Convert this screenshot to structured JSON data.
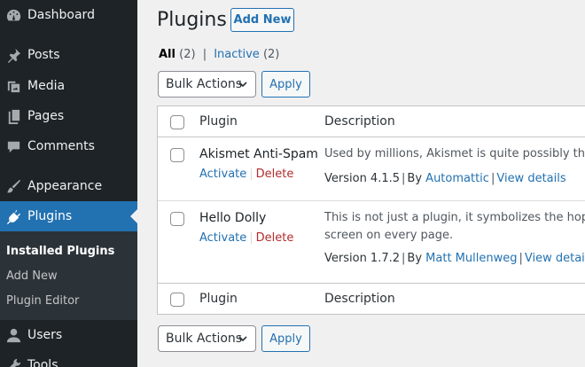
{
  "sidebar": {
    "items": [
      {
        "label": "Dashboard",
        "icon": "dashboard-icon"
      },
      {
        "label": "Posts",
        "icon": "pin-icon"
      },
      {
        "label": "Media",
        "icon": "media-icon"
      },
      {
        "label": "Pages",
        "icon": "pages-icon"
      },
      {
        "label": "Comments",
        "icon": "comment-icon"
      },
      {
        "label": "Appearance",
        "icon": "brush-icon"
      },
      {
        "label": "Plugins",
        "icon": "plug-icon",
        "active": true
      },
      {
        "label": "Users",
        "icon": "user-icon"
      },
      {
        "label": "Tools",
        "icon": "wrench-icon"
      }
    ],
    "submenu": [
      "Installed Plugins",
      "Add New",
      "Plugin Editor"
    ]
  },
  "header": {
    "title": "Plugins",
    "add_new": "Add New"
  },
  "filters": {
    "all_label": "All",
    "all_count": "(2)",
    "separator": "|",
    "inactive_label": "Inactive",
    "inactive_count": "(2)"
  },
  "bulk": {
    "select_value": "Bulk Actions",
    "apply": "Apply"
  },
  "table": {
    "columns": [
      "Plugin",
      "Description"
    ],
    "rows": [
      {
        "name": "Akismet Anti-Spam",
        "activate": "Activate",
        "delete": "Delete",
        "description": [
          "Used by millions, Akismet is quite possibly the best"
        ],
        "version": "Version 4.1.5",
        "by": "By",
        "author": "Automattic",
        "view_details": "View details"
      },
      {
        "name": "Hello Dolly",
        "activate": "Activate",
        "delete": "Delete",
        "description": [
          "This is not just a plugin, it symbolizes the hope and e",
          "screen on every page."
        ],
        "version": "Version 1.7.2",
        "by": "By",
        "author": "Matt Mullenweg",
        "view_details": "View details"
      }
    ]
  },
  "colors": {
    "sidebar_bg": "#1d2327",
    "active_bg": "#2271b1",
    "link": "#2271b1",
    "delete": "#b32d2e"
  }
}
